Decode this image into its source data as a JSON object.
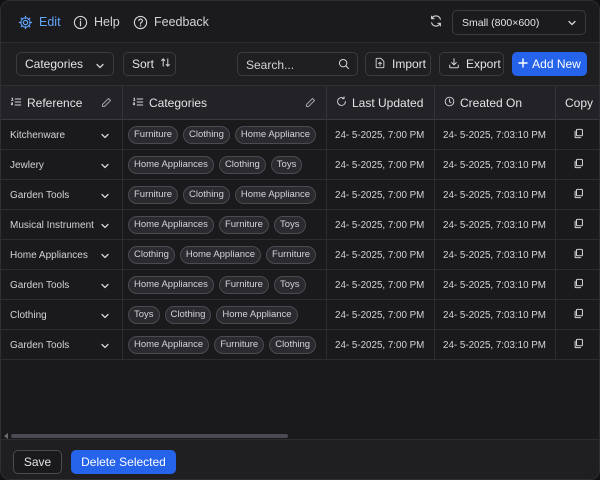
{
  "nav": {
    "edit_label": "Edit",
    "help_label": "Help",
    "feedback_label": "Feedback",
    "active_color": "#60a5fa"
  },
  "size_select": {
    "value": "Small (800×600)"
  },
  "toolbar": {
    "categories_label": "Categories",
    "sort_label": "Sort",
    "search_placeholder": "Search...",
    "import_label": "Import",
    "export_label": "Export",
    "add_new_label": "Add New",
    "accent_color": "#2563eb"
  },
  "table": {
    "columns": {
      "reference": "Reference",
      "categories": "Categories",
      "last_updated": "Last Updated",
      "created_on": "Created On",
      "copy": "Copy"
    },
    "rows": [
      {
        "reference": "Kitchenware",
        "tags": [
          "Furniture",
          "Clothing",
          "Home Appliance"
        ],
        "updated": "24- 5-2025, 7:00 PM",
        "created": "24- 5-2025, 7:03:10 PM"
      },
      {
        "reference": "Jewlery",
        "tags": [
          "Home Appliances",
          "Clothing",
          "Toys"
        ],
        "updated": "24- 5-2025, 7:00 PM",
        "created": "24- 5-2025, 7:03:10 PM"
      },
      {
        "reference": "Garden Tools",
        "tags": [
          "Furniture",
          "Clothing",
          "Home Appliance"
        ],
        "updated": "24- 5-2025, 7:00 PM",
        "created": "24- 5-2025, 7:03:10 PM"
      },
      {
        "reference": "Musical Instrument",
        "tags": [
          "Home Appliances",
          "Furniture",
          "Toys"
        ],
        "updated": "24- 5-2025, 7:00 PM",
        "created": "24- 5-2025, 7:03:10 PM"
      },
      {
        "reference": "Home Appliances",
        "tags": [
          "Clothing",
          "Home Appliance",
          "Furniture"
        ],
        "updated": "24- 5-2025, 7:00 PM",
        "created": "24- 5-2025, 7:03:10 PM"
      },
      {
        "reference": "Garden Tools",
        "tags": [
          "Home Appliances",
          "Furniture",
          "Toys"
        ],
        "updated": "24- 5-2025, 7:00 PM",
        "created": "24- 5-2025, 7:03:10 PM"
      },
      {
        "reference": "Clothing",
        "tags": [
          "Toys",
          "Clothing",
          "Home Appliance"
        ],
        "updated": "24- 5-2025, 7:00 PM",
        "created": "24- 5-2025, 7:03:10 PM"
      },
      {
        "reference": "Garden Tools",
        "tags": [
          "Home Appliance",
          "Furniture",
          "Clothing"
        ],
        "updated": "24- 5-2025, 7:00 PM",
        "created": "24- 5-2025, 7:03:10 PM"
      }
    ]
  },
  "footer": {
    "save_label": "Save",
    "delete_label": "Delete Selected"
  }
}
